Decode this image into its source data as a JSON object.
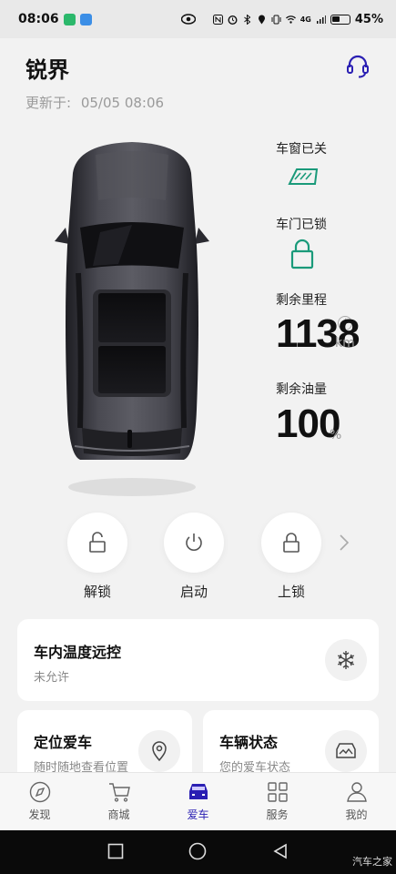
{
  "status_bar": {
    "time": "08:06",
    "battery_pct": "45%",
    "signal_tag": "4G"
  },
  "header": {
    "title": "锐界",
    "update_label": "更新于:",
    "update_time": "05/05 08:06"
  },
  "vehicle_status": {
    "window_label": "车窗已关",
    "door_label": "车门已锁",
    "range_label": "剩余里程",
    "range_value": "1138",
    "range_unit": "km",
    "fuel_label": "剩余油量",
    "fuel_value": "100",
    "fuel_unit": "%"
  },
  "actions": [
    {
      "label": "解锁",
      "icon": "unlock-icon"
    },
    {
      "label": "启动",
      "icon": "power-icon"
    },
    {
      "label": "上锁",
      "icon": "lock-icon"
    }
  ],
  "cards": {
    "climate": {
      "title": "车内温度远控",
      "subtitle": "未允许",
      "icon": "snowflake-icon"
    },
    "locate": {
      "title": "定位爱车",
      "subtitle": "随时随地查看位置",
      "icon": "location-pin-icon"
    },
    "vehicle": {
      "title": "车辆状态",
      "subtitle": "您的爱车状态",
      "icon": "car-status-icon"
    }
  },
  "tabs": [
    {
      "label": "发现",
      "icon": "compass-icon"
    },
    {
      "label": "商城",
      "icon": "cart-icon"
    },
    {
      "label": "爱车",
      "icon": "car-icon",
      "active": true
    },
    {
      "label": "服务",
      "icon": "grid-icon"
    },
    {
      "label": "我的",
      "icon": "person-icon"
    }
  ],
  "watermark": "汽车之家",
  "colors": {
    "accent": "#2a1fb3",
    "status_green": "#1a9a7a"
  }
}
